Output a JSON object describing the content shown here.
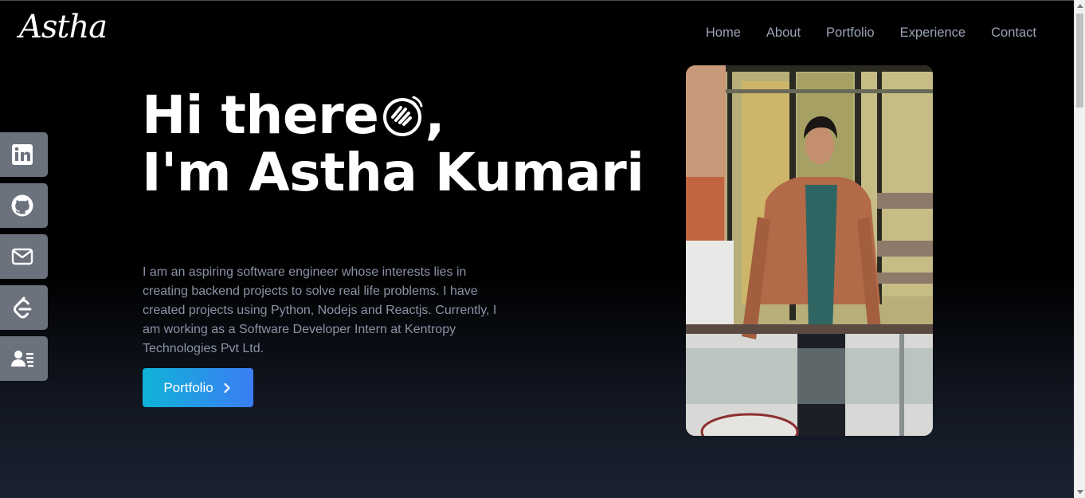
{
  "header": {
    "logo": "Astha",
    "nav": [
      {
        "label": "Home"
      },
      {
        "label": "About"
      },
      {
        "label": "Portfolio"
      },
      {
        "label": "Experience"
      },
      {
        "label": "Contact"
      }
    ]
  },
  "hero": {
    "greeting": "Hi there",
    "greeting_suffix": ",",
    "name_line": "I'm Astha Kumari",
    "description": "I am an aspiring software engineer whose interests lies in creating backend projects to solve real life problems. I have created projects using Python, Nodejs and Reactjs. Currently, I am working as a Software Developer Intern at Kentropy Technologies Pvt Ltd.",
    "button_label": "Portfolio"
  },
  "social": [
    {
      "icon": "linkedin-icon"
    },
    {
      "icon": "github-icon"
    },
    {
      "icon": "mail-icon"
    },
    {
      "icon": "leetcode-icon"
    },
    {
      "icon": "resume-icon"
    }
  ],
  "colors": {
    "nav_text": "#9aa3b5",
    "description_text": "#8a93a6",
    "button_gradient_start": "#10b3d8",
    "button_gradient_end": "#3b7df4",
    "social_bg": "#6b717d"
  }
}
